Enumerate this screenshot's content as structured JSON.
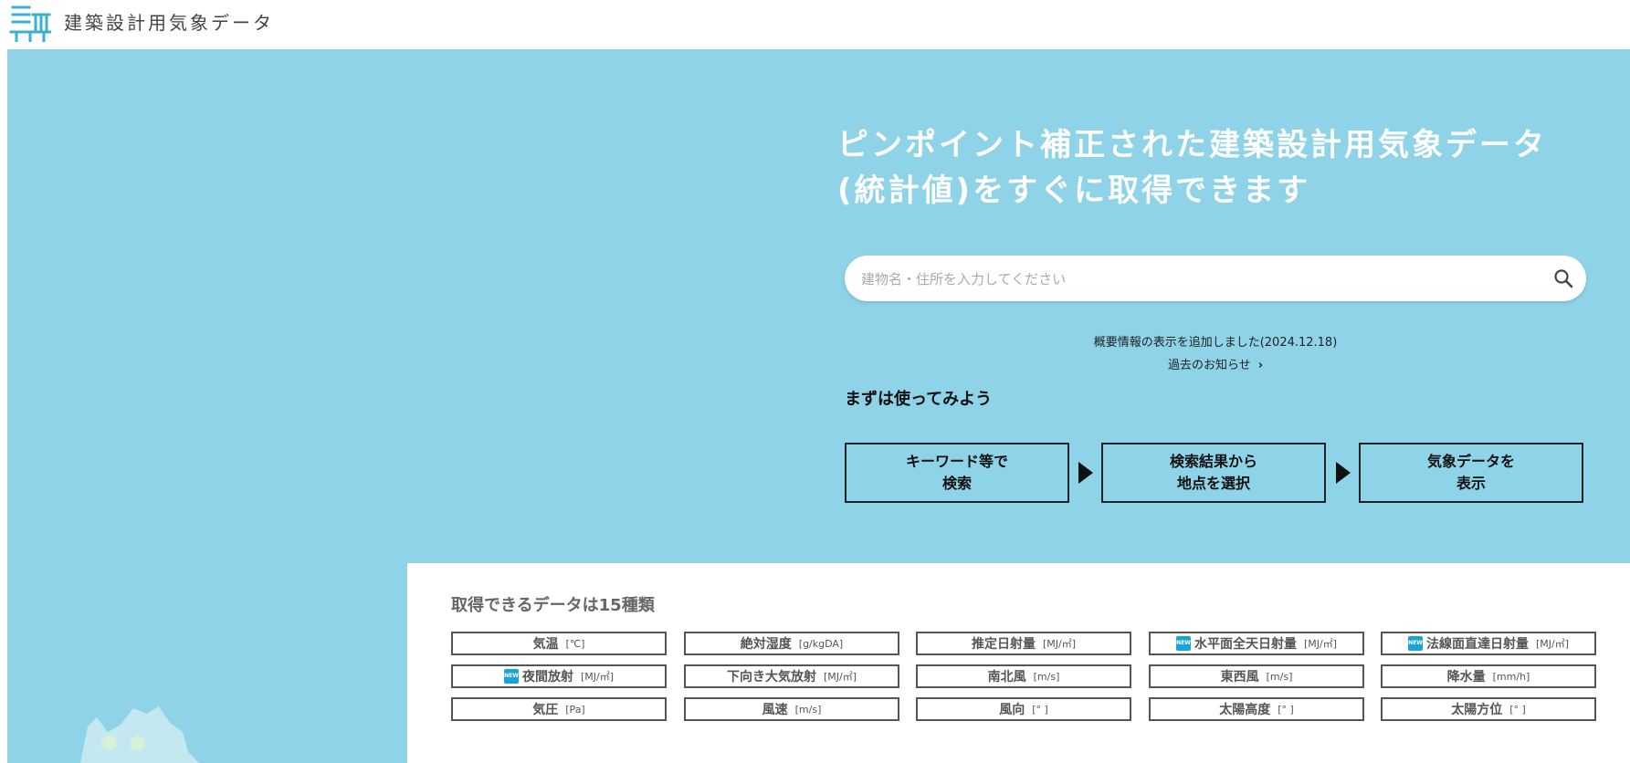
{
  "header": {
    "site_title": "建築設計用気象データ",
    "logo_icon": "building-logo-icon",
    "logo_color": "#3ab2cf"
  },
  "hero": {
    "background_color": "#8ed3e8",
    "title_line1": "ピンポイント補正された建築設計用気象データ",
    "title_line2": "(統計値)をすぐに取得できます",
    "search": {
      "value": "",
      "placeholder": "建物名・住所を入力してください",
      "icon": "search-icon"
    },
    "news": {
      "latest": "概要情報の表示を追加しました(2024.12.18)",
      "past_link": "過去のお知らせ",
      "chevron": "›"
    },
    "try_heading": "まずは使ってみよう",
    "steps": [
      {
        "label": "キーワード等で\n検索"
      },
      {
        "label": "検索結果から\n地点を選択"
      },
      {
        "label": "気象データを\n表示"
      }
    ]
  },
  "data_panel": {
    "title": "取得できるデータは15種類",
    "new_badge_label": "NEW",
    "new_badge_color": "#19a3d6",
    "items": [
      {
        "name": "気温",
        "unit": "[℃]",
        "new": false
      },
      {
        "name": "絶対湿度",
        "unit": "[g/kgDA]",
        "new": false
      },
      {
        "name": "推定日射量",
        "unit": "[MJ/㎡]",
        "new": false
      },
      {
        "name": "水平面全天日射量",
        "unit": "[MJ/㎡]",
        "new": true
      },
      {
        "name": "法線面直達日射量",
        "unit": "[MJ/㎡]",
        "new": true
      },
      {
        "name": "夜間放射",
        "unit": "[MJ/㎡]",
        "new": true
      },
      {
        "name": "下向き大気放射",
        "unit": "[MJ/㎡]",
        "new": false
      },
      {
        "name": "南北風",
        "unit": "[m/s]",
        "new": false
      },
      {
        "name": "東西風",
        "unit": "[m/s]",
        "new": false
      },
      {
        "name": "降水量",
        "unit": "[mm/h]",
        "new": false
      },
      {
        "name": "気圧",
        "unit": "[Pa]",
        "new": false
      },
      {
        "name": "風速",
        "unit": "[m/s]",
        "new": false
      },
      {
        "name": "風向",
        "unit": "[° ]",
        "new": false
      },
      {
        "name": "太陽高度",
        "unit": "[° ]",
        "new": false
      },
      {
        "name": "太陽方位",
        "unit": "[° ]",
        "new": false
      }
    ]
  }
}
